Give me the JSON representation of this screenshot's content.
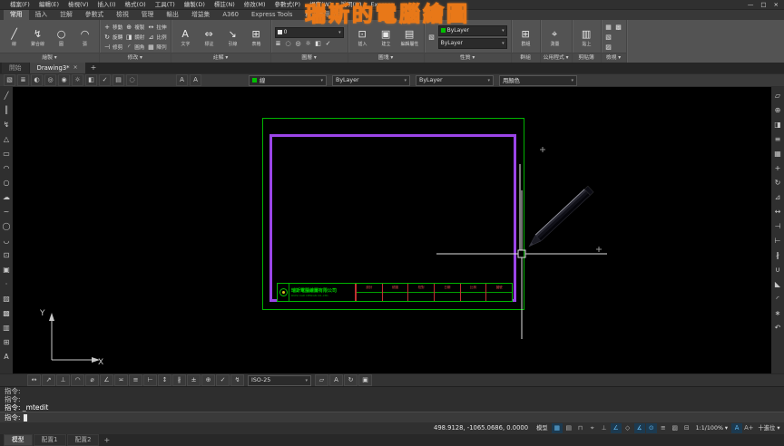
{
  "watermark": "瑞斯的電腦繪圖",
  "menu": {
    "items": [
      "檔案(F)",
      "編輯(E)",
      "檢視(V)",
      "插入(I)",
      "格式(O)",
      "工具(T)",
      "繪製(D)",
      "標註(N)",
      "修改(M)",
      "參數式(P)",
      "視窗(W)",
      "說明(H)",
      "Express"
    ],
    "window_buttons": [
      {
        "name": "minimize",
        "glyph": "—"
      },
      {
        "name": "restore",
        "glyph": "□"
      },
      {
        "name": "close",
        "glyph": "×"
      }
    ]
  },
  "ribbon": {
    "tabs": [
      "常用",
      "插入",
      "註解",
      "參數式",
      "檢視",
      "管理",
      "輸出",
      "增益集",
      "A360",
      "Express Tools",
      "精選應用程式"
    ],
    "active_tab": "常用",
    "panels": [
      {
        "label": "繪製",
        "flyout": true,
        "type": "big",
        "tools": [
          {
            "name": "line",
            "glyph": "╱",
            "label": "線"
          },
          {
            "name": "polyline",
            "glyph": "↯",
            "label": "聚合線"
          },
          {
            "name": "circle",
            "glyph": "○",
            "label": "圓"
          },
          {
            "name": "arc",
            "glyph": "◠",
            "label": "弧"
          }
        ]
      },
      {
        "label": "修改",
        "flyout": true,
        "type": "small",
        "tools": [
          {
            "name": "move",
            "glyph": "+",
            "label": "移動"
          },
          {
            "name": "rotate",
            "glyph": "↻",
            "label": "旋轉"
          },
          {
            "name": "trim",
            "glyph": "⊣",
            "label": "修剪"
          },
          {
            "name": "copy",
            "glyph": "⊕",
            "label": "複製"
          },
          {
            "name": "mirror",
            "glyph": "◨",
            "label": "鏡射"
          },
          {
            "name": "fillet",
            "glyph": "◜",
            "label": "圓角"
          },
          {
            "name": "stretch",
            "glyph": "↔",
            "label": "拉伸"
          },
          {
            "name": "scale",
            "glyph": "⊿",
            "label": "比例"
          },
          {
            "name": "array",
            "glyph": "▦",
            "label": "陣列"
          }
        ]
      },
      {
        "label": "註解",
        "flyout": true,
        "type": "big",
        "tools": [
          {
            "name": "text",
            "glyph": "A",
            "label": "文字"
          },
          {
            "name": "dimension",
            "glyph": "⇔",
            "label": "標註"
          },
          {
            "name": "leader",
            "glyph": "↘",
            "label": "引線"
          },
          {
            "name": "table",
            "glyph": "⊞",
            "label": "表格"
          }
        ]
      },
      {
        "label": "圖層",
        "flyout": true,
        "type": "layer",
        "combo_value": "0",
        "combo_swatch": "#e8e8e8",
        "tools": [
          {
            "name": "layer-properties",
            "glyph": "≣"
          },
          {
            "name": "layer-off",
            "glyph": "◌"
          },
          {
            "name": "layer-isolate",
            "glyph": "◎"
          },
          {
            "name": "layer-freeze",
            "glyph": "☼"
          },
          {
            "name": "layer-lock",
            "glyph": "◧"
          },
          {
            "name": "layer-match",
            "glyph": "✓"
          }
        ]
      },
      {
        "label": "圖塊",
        "flyout": true,
        "type": "big",
        "tools": [
          {
            "name": "insert-block",
            "glyph": "⊡",
            "label": "插入"
          },
          {
            "name": "create-block",
            "glyph": "▣",
            "label": "建立"
          },
          {
            "name": "edit-attribute",
            "glyph": "▤",
            "label": "編輯屬性"
          }
        ]
      },
      {
        "label": "性質",
        "flyout": true,
        "type": "props",
        "combos": [
          {
            "name": "object-color",
            "swatch": "#00c000",
            "value": "ByLayer"
          },
          {
            "name": "linetype",
            "value": "ByLayer"
          }
        ],
        "side_icon": {
          "name": "match-properties",
          "glyph": "▧"
        }
      },
      {
        "label": "群組",
        "flyout": false,
        "type": "big",
        "tools": [
          {
            "name": "group",
            "glyph": "⊞",
            "label": "群組"
          }
        ]
      },
      {
        "label": "公用程式",
        "flyout": true,
        "type": "big",
        "tools": [
          {
            "name": "measure",
            "glyph": "⌖",
            "label": "測量"
          }
        ]
      },
      {
        "label": "剪貼簿",
        "flyout": false,
        "type": "big",
        "tools": [
          {
            "name": "paste",
            "glyph": "▥",
            "label": "貼上"
          }
        ]
      },
      {
        "label": "檢視",
        "flyout": true,
        "type": "small",
        "tools": [
          {
            "name": "view-navigate",
            "glyph": "▦",
            "label": ""
          },
          {
            "name": "view-viewports",
            "glyph": "▧",
            "label": ""
          },
          {
            "name": "view-palettes",
            "glyph": "▨",
            "label": ""
          },
          {
            "name": "view-interface",
            "glyph": "▩",
            "label": ""
          }
        ]
      }
    ]
  },
  "file_tabs": {
    "tabs": [
      {
        "label": "開始",
        "active": false
      },
      {
        "label": "Drawing3*",
        "active": true
      }
    ],
    "close_glyph": "×",
    "add_button": "+"
  },
  "properties_toolbar": {
    "icons": [
      {
        "name": "match-properties",
        "glyph": "▧"
      },
      {
        "name": "layer-states",
        "glyph": "≣"
      },
      {
        "name": "layer-previous",
        "glyph": "◐"
      },
      {
        "name": "layer-isolate",
        "glyph": "◎"
      },
      {
        "name": "layer-unisolate",
        "glyph": "◉"
      },
      {
        "name": "layer-freeze",
        "glyph": "☼"
      },
      {
        "name": "layer-lock",
        "glyph": "◧"
      },
      {
        "name": "make-current",
        "glyph": "✓"
      },
      {
        "name": "layer-walk",
        "glyph": "▤"
      },
      {
        "name": "layer-off",
        "glyph": "◌"
      }
    ],
    "style_icons": [
      {
        "name": "text-style",
        "glyph": "A"
      },
      {
        "name": "dimension-style",
        "glyph": "A"
      }
    ],
    "combos": [
      {
        "name": "layer-combo",
        "swatch": "#00c000",
        "value": "線"
      },
      {
        "name": "color-combo",
        "value": "ByLayer"
      },
      {
        "name": "linetype-combo",
        "value": "ByLayer"
      },
      {
        "name": "plotstyle-combo",
        "value": "用顏色"
      }
    ]
  },
  "draw_toolbar": [
    {
      "name": "line",
      "glyph": "╱"
    },
    {
      "name": "construction-line",
      "glyph": "║"
    },
    {
      "name": "polyline",
      "glyph": "↯"
    },
    {
      "name": "polygon",
      "glyph": "△"
    },
    {
      "name": "rectangle",
      "glyph": "▭"
    },
    {
      "name": "arc",
      "glyph": "◠"
    },
    {
      "name": "circle",
      "glyph": "○"
    },
    {
      "name": "revision-cloud",
      "glyph": "☁"
    },
    {
      "name": "spline",
      "glyph": "~"
    },
    {
      "name": "ellipse",
      "glyph": "◯"
    },
    {
      "name": "ellipse-arc",
      "glyph": "◡"
    },
    {
      "name": "insert-block",
      "glyph": "⊡"
    },
    {
      "name": "create-block",
      "glyph": "▣"
    },
    {
      "name": "point",
      "glyph": "·"
    },
    {
      "name": "hatch",
      "glyph": "▨"
    },
    {
      "name": "gradient",
      "glyph": "▩"
    },
    {
      "name": "region",
      "glyph": "▥"
    },
    {
      "name": "table",
      "glyph": "⊞"
    },
    {
      "name": "multiline-text",
      "glyph": "A"
    }
  ],
  "modify_toolbar": [
    {
      "name": "erase",
      "glyph": "▱"
    },
    {
      "name": "copy",
      "glyph": "⊕"
    },
    {
      "name": "mirror",
      "glyph": "◨"
    },
    {
      "name": "offset",
      "glyph": "≡"
    },
    {
      "name": "array",
      "glyph": "▦"
    },
    {
      "name": "move",
      "glyph": "+"
    },
    {
      "name": "rotate",
      "glyph": "↻"
    },
    {
      "name": "scale",
      "glyph": "⊿"
    },
    {
      "name": "stretch",
      "glyph": "↔"
    },
    {
      "name": "trim",
      "glyph": "⊣"
    },
    {
      "name": "extend",
      "glyph": "⊢"
    },
    {
      "name": "break",
      "glyph": "∦"
    },
    {
      "name": "join",
      "glyph": "∪"
    },
    {
      "name": "chamfer",
      "glyph": "◣"
    },
    {
      "name": "fillet",
      "glyph": "◜"
    },
    {
      "name": "explode",
      "glyph": "∗"
    },
    {
      "name": "undo",
      "glyph": "↶"
    }
  ],
  "dimension_toolbar": {
    "icons_before": [
      {
        "name": "dim-linear",
        "glyph": "↔"
      },
      {
        "name": "dim-aligned",
        "glyph": "↗"
      },
      {
        "name": "dim-ordinate",
        "glyph": "⊥"
      },
      {
        "name": "dim-radius",
        "glyph": "◠"
      },
      {
        "name": "dim-diameter",
        "glyph": "⌀"
      },
      {
        "name": "dim-angular",
        "glyph": "∠"
      },
      {
        "name": "dim-quick",
        "glyph": "≍"
      },
      {
        "name": "dim-baseline",
        "glyph": "≡"
      },
      {
        "name": "dim-continue",
        "glyph": "⊢"
      },
      {
        "name": "dim-spacing",
        "glyph": "↕"
      },
      {
        "name": "dim-break",
        "glyph": "∦"
      },
      {
        "name": "dim-tolerance",
        "glyph": "±"
      },
      {
        "name": "dim-center-mark",
        "glyph": "⊕"
      },
      {
        "name": "dim-inspect",
        "glyph": "✓"
      },
      {
        "name": "dim-jogged",
        "glyph": "↯"
      }
    ],
    "style_combo": "ISO-25",
    "icons_after": [
      {
        "name": "dim-edit",
        "glyph": "▱"
      },
      {
        "name": "dim-text-edit",
        "glyph": "A"
      },
      {
        "name": "dim-update",
        "glyph": "↻"
      },
      {
        "name": "dim-style-manager",
        "glyph": "▣"
      }
    ]
  },
  "canvas": {
    "ucs": {
      "x_label": "X",
      "y_label": "Y"
    },
    "title_block": {
      "company": "瑞斯電腦繪圖有限公司",
      "company_sub": "RUISI CAD DESIGN CO.,LTD.",
      "fields": [
        {
          "label": "設計"
        },
        {
          "label": "繪圖"
        },
        {
          "label": "校對"
        },
        {
          "label": "日期"
        },
        {
          "label": "比例"
        },
        {
          "label": "圖號"
        }
      ]
    }
  },
  "command_line": {
    "history": [
      "指令:",
      "指令:",
      "指令: _mtedit"
    ],
    "prompt": "指令:"
  },
  "status_bar": {
    "coordinates": "498.9128, -1065.0686, 0.0000",
    "model_button": "模型",
    "toggles": [
      {
        "name": "grid-display",
        "glyph": "▦",
        "on": true
      },
      {
        "name": "snap-mode",
        "glyph": "▤",
        "on": false
      },
      {
        "name": "infer-constraints",
        "glyph": "⊓",
        "on": false
      },
      {
        "name": "dynamic-input",
        "glyph": "⌖",
        "on": false
      },
      {
        "name": "ortho-mode",
        "glyph": "⊥",
        "on": false
      },
      {
        "name": "polar-tracking",
        "glyph": "∠",
        "on": true
      },
      {
        "name": "isometric-drafting",
        "glyph": "◇",
        "on": false
      },
      {
        "name": "object-snap-tracking",
        "glyph": "∡",
        "on": true
      },
      {
        "name": "object-snap",
        "glyph": "⊙",
        "on": true
      },
      {
        "name": "lineweight-display",
        "glyph": "≡",
        "on": false
      },
      {
        "name": "transparency",
        "glyph": "▨",
        "on": false
      },
      {
        "name": "selection-cycling",
        "glyph": "⊟",
        "on": false
      }
    ],
    "annotation_scale": "1:1/100%",
    "annotation_icons": [
      {
        "name": "annotation-visibility",
        "glyph": "A",
        "on": true
      },
      {
        "name": "annotation-autoscale",
        "glyph": "A+",
        "on": false
      }
    ],
    "units": "十進位",
    "dropdown_arrow": "▾",
    "right_icons": [
      {
        "name": "isolate-objects",
        "glyph": "◎"
      },
      {
        "name": "graphics-performance",
        "glyph": "☼"
      },
      {
        "name": "clean-screen",
        "glyph": "▢"
      }
    ]
  },
  "layout_tabs": {
    "tabs": [
      {
        "label": "模型",
        "active": true
      },
      {
        "label": "配置1",
        "active": false
      },
      {
        "label": "配置2",
        "active": false
      }
    ],
    "add_button": "+"
  }
}
